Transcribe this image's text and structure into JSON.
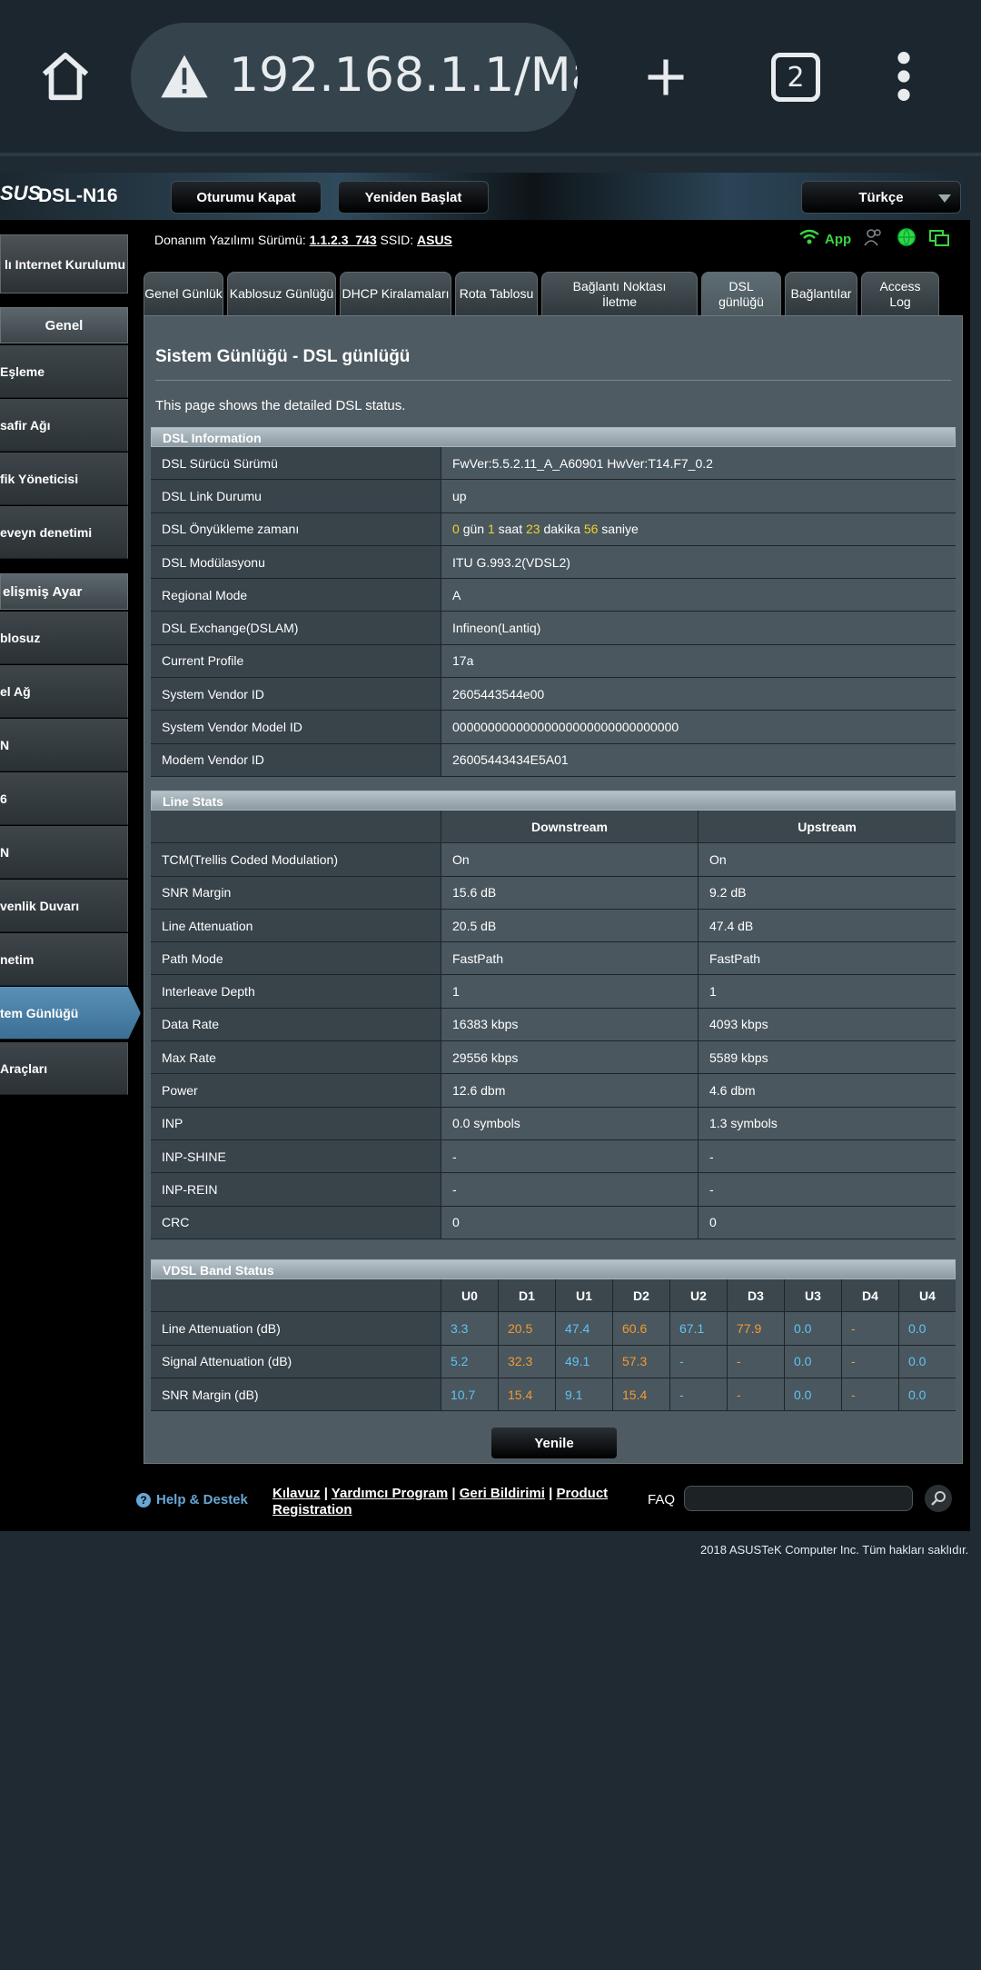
{
  "browser": {
    "url": "192.168.1.1/Ma",
    "tab_count": "2"
  },
  "header": {
    "logo": "SUS",
    "model": "DSL-N16",
    "logout_label": "Oturumu Kapat",
    "reboot_label": "Yeniden Başlat",
    "language": "Türkçe"
  },
  "sidebar": {
    "quick_setup": "lı Internet Kurulumu",
    "general_header": "Genel",
    "general_items": [
      {
        "label": "Eşleme"
      },
      {
        "label": "safir Ağı"
      },
      {
        "label": "fik Yöneticisi"
      },
      {
        "label": "eveyn denetimi"
      }
    ],
    "advanced_header": "elişmiş Ayar",
    "advanced_items": [
      {
        "label": "blosuz"
      },
      {
        "label": "el Ağ"
      },
      {
        "label": "N"
      },
      {
        "label": "6"
      },
      {
        "label": "N"
      },
      {
        "label": "venlik Duvarı"
      },
      {
        "label": "netim"
      },
      {
        "label": "tem Günlüğü"
      },
      {
        "label": "Araçları"
      }
    ]
  },
  "status": {
    "fw_label": "Donanım Yazılımı Sürümü:",
    "fw_value": "1.1.2.3_743",
    "ssid_label": "SSID:",
    "ssid_value": "ASUS",
    "app_label": "App"
  },
  "tabs": [
    {
      "label": "Genel Günlük"
    },
    {
      "label": "Kablosuz Günlüğü"
    },
    {
      "label": "DHCP Kiralamaları"
    },
    {
      "label": "Rota Tablosu"
    },
    {
      "label": "Bağlantı Noktası İletme"
    },
    {
      "label": "DSL günlüğü"
    },
    {
      "label": "Bağlantılar"
    },
    {
      "label": "Access Log"
    }
  ],
  "main": {
    "title": "Sistem Günlüğü - DSL günlüğü",
    "description": "This page shows the detailed DSL status.",
    "refresh_label": "Yenile"
  },
  "dsl_info": {
    "header": "DSL Information",
    "rows": [
      {
        "label": "DSL Sürücü Sürümü",
        "value": "FwVer:5.5.2.11_A_A60901 HwVer:T14.F7_0.2"
      },
      {
        "label": "DSL Link Durumu",
        "value": "up"
      },
      {
        "label": "DSL Önyükleme zamanı",
        "value": ""
      },
      {
        "label": "DSL Modülasyonu",
        "value": "ITU G.993.2(VDSL2)"
      },
      {
        "label": "Regional Mode",
        "value": "A"
      },
      {
        "label": "DSL Exchange(DSLAM)",
        "value": "Infineon(Lantiq)"
      },
      {
        "label": "Current Profile",
        "value": "17a"
      },
      {
        "label": "System Vendor ID",
        "value": "2605443544e00"
      },
      {
        "label": "System Vendor Model ID",
        "value": "00000000000000000000000000000000"
      },
      {
        "label": "Modem Vendor ID",
        "value": "26005443434E5A01"
      }
    ],
    "uptime": {
      "days": "0",
      "days_unit": "gün",
      "hours": "1",
      "hours_unit": "saat",
      "minutes": "23",
      "minutes_unit": "dakika",
      "seconds": "56",
      "seconds_unit": "saniye"
    }
  },
  "line_stats": {
    "header": "Line Stats",
    "col_down": "Downstream",
    "col_up": "Upstream",
    "rows": [
      {
        "label": "TCM(Trellis Coded Modulation)",
        "down": "On",
        "up": "On"
      },
      {
        "label": "SNR Margin",
        "down": "15.6 dB",
        "up": "9.2 dB"
      },
      {
        "label": "Line Attenuation",
        "down": "20.5 dB",
        "up": "47.4 dB"
      },
      {
        "label": "Path Mode",
        "down": "FastPath",
        "up": "FastPath"
      },
      {
        "label": "Interleave Depth",
        "down": "1",
        "up": "1"
      },
      {
        "label": "Data Rate",
        "down": "16383 kbps",
        "up": "4093 kbps"
      },
      {
        "label": "Max Rate",
        "down": "29556 kbps",
        "up": "5589 kbps"
      },
      {
        "label": "Power",
        "down": "12.6 dbm",
        "up": "4.6 dbm"
      },
      {
        "label": "INP",
        "down": "0.0 symbols",
        "up": "1.3 symbols"
      },
      {
        "label": "INP-SHINE",
        "down": "-",
        "up": "-"
      },
      {
        "label": "INP-REIN",
        "down": "-",
        "up": "-"
      },
      {
        "label": "CRC",
        "down": "0",
        "up": "0"
      }
    ]
  },
  "vdsl_band": {
    "header": "VDSL Band Status",
    "columns": [
      "U0",
      "D1",
      "U1",
      "D2",
      "U2",
      "D3",
      "U3",
      "D4",
      "U4"
    ],
    "rows": [
      {
        "label": "Line Attenuation (dB)",
        "values": [
          "3.3",
          "20.5",
          "47.4",
          "60.6",
          "67.1",
          "77.9",
          "0.0",
          "-",
          "0.0"
        ]
      },
      {
        "label": "Signal Attenuation (dB)",
        "values": [
          "5.2",
          "32.3",
          "49.1",
          "57.3",
          "-",
          "-",
          "0.0",
          "-",
          "0.0"
        ]
      },
      {
        "label": "SNR Margin (dB)",
        "values": [
          "10.7",
          "15.4",
          "9.1",
          "15.4",
          "-",
          "-",
          "0.0",
          "-",
          "0.0"
        ]
      }
    ],
    "colors": {
      "upstream": "#5fc4f5",
      "downstream": "#f29b34"
    }
  },
  "footer": {
    "help_label": "Help & Destek",
    "link1": "Kılavuz",
    "link2": "Yardımcı Program",
    "link3": "Geri Bildirimi",
    "link4": "Product Registration",
    "sep": "|",
    "faq_label": "FAQ",
    "copyright": "2018 ASUSTeK Computer Inc. Tüm hakları saklıdır."
  }
}
